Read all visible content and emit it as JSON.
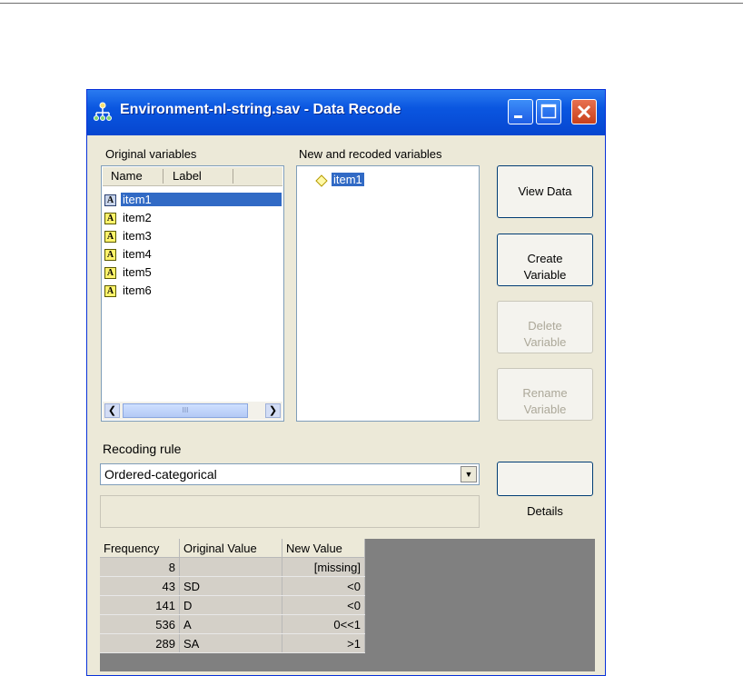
{
  "window": {
    "title": "Environment-nl-string.sav - Data Recode"
  },
  "labels": {
    "original_variables": "Original variables",
    "new_variables": "New and recoded variables",
    "recoding_rule": "Recoding rule"
  },
  "original_list": {
    "columns": [
      "Name",
      "Label"
    ],
    "items": [
      "item1",
      "item2",
      "item3",
      "item4",
      "item5",
      "item6"
    ],
    "selected": "item1",
    "scroll_grip": "III"
  },
  "new_list": {
    "items": [
      "item1"
    ]
  },
  "buttons": {
    "view_data": "View Data",
    "create_variable": "Create\nVariable",
    "delete_variable": "Delete\nVariable",
    "rename_variable": "Rename\nVariable",
    "details": "Details"
  },
  "recoding_rule": {
    "value": "Ordered-categorical"
  },
  "table": {
    "headers": [
      "Frequency",
      "Original Value",
      "New Value"
    ],
    "rows": [
      {
        "frequency": "8",
        "original": "",
        "new": "[missing]"
      },
      {
        "frequency": "43",
        "original": "SD",
        "new": "<0"
      },
      {
        "frequency": "141",
        "original": "D",
        "new": "<0"
      },
      {
        "frequency": "536",
        "original": "A",
        "new": "0<<1"
      },
      {
        "frequency": "289",
        "original": "SA",
        "new": ">1"
      }
    ]
  },
  "colors": {
    "titlebar": "#0a56e0",
    "selection": "#316ac5",
    "face": "#ece9d8"
  }
}
